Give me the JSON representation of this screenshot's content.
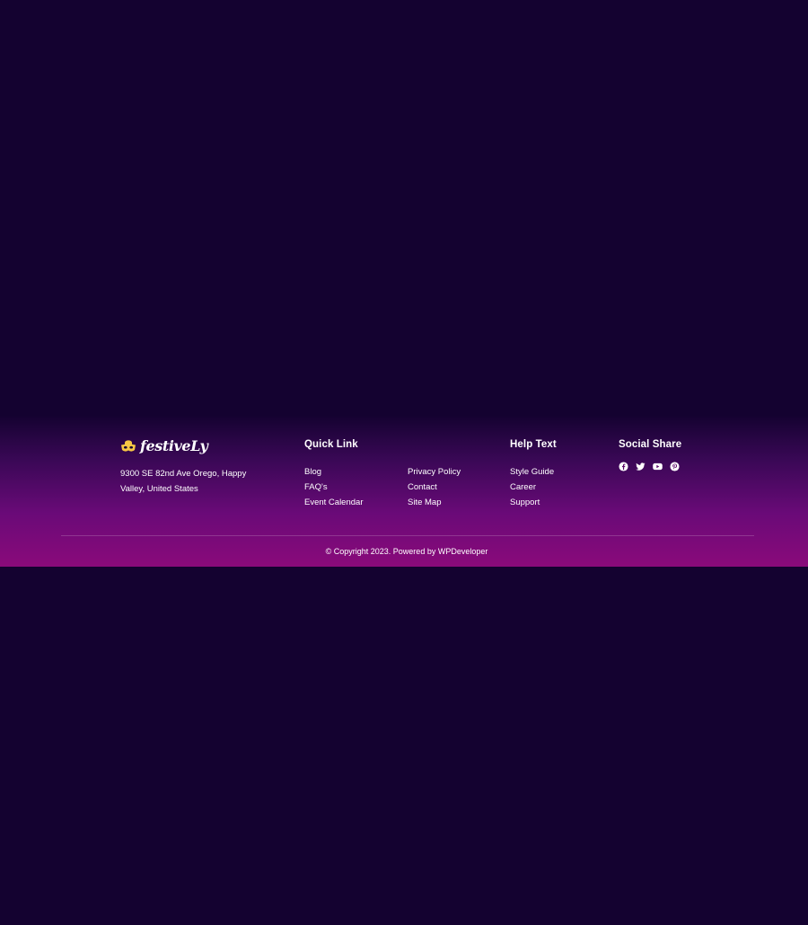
{
  "brand": {
    "logo_text": "festiveLy",
    "logo_icon": "mask-icon",
    "address": "9300 SE 82nd Ave Orego, Happy Valley, United States"
  },
  "quick_link": {
    "title": "Quick Link",
    "col1": [
      "Blog",
      "FAQ's",
      "Event Calendar"
    ],
    "col2": [
      "Privacy Policy",
      "Contact",
      "Site Map"
    ]
  },
  "help_text": {
    "title": "Help Text",
    "items": [
      "Style Guide",
      "Career",
      "Support"
    ]
  },
  "social_share": {
    "title": "Social Share",
    "icons": [
      "facebook-icon",
      "twitter-icon",
      "youtube-icon",
      "pinterest-icon"
    ]
  },
  "footer_bottom": {
    "copyright_prefix": "© Copyright 2023. Powered by ",
    "powered_by_link": "WPDeveloper"
  },
  "colors": {
    "page_background": "#140230",
    "footer_gradient_start": "#3a0856",
    "footer_gradient_end": "#8a0a7a",
    "logo_accent": "#f7c744",
    "text": "#ffffff"
  }
}
